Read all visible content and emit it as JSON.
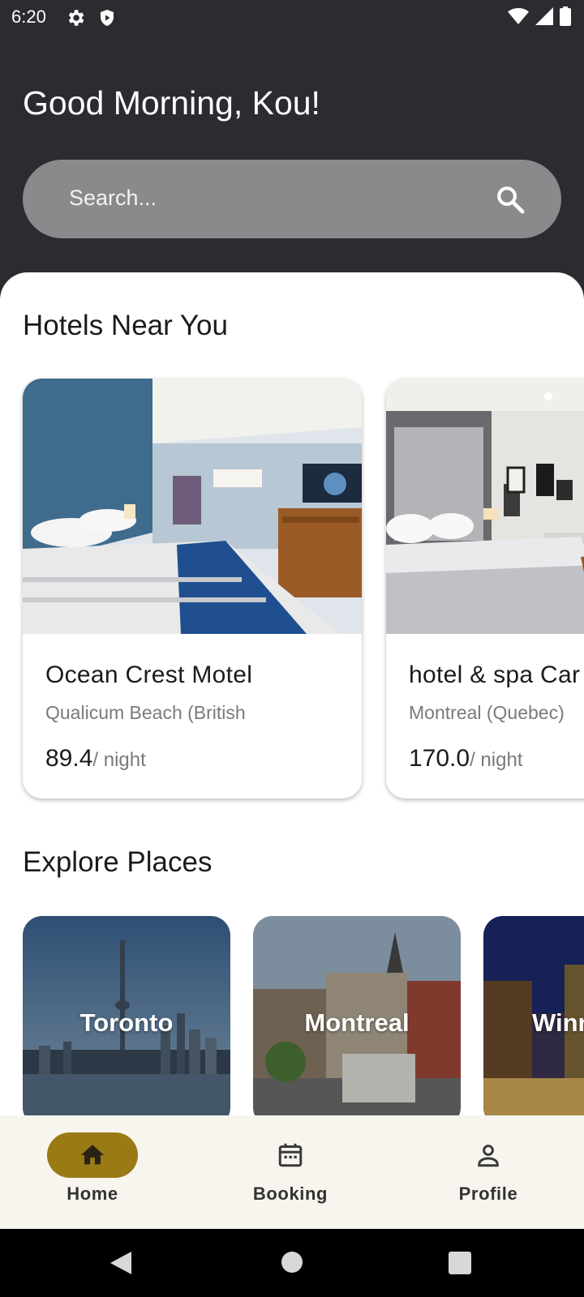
{
  "status_bar": {
    "time": "6:20",
    "left_icons": [
      "gear-icon",
      "shield-icon"
    ],
    "right_icons": [
      "wifi-icon",
      "signal-icon",
      "battery-icon"
    ]
  },
  "header": {
    "greeting": "Good Morning, Kou!",
    "search": {
      "placeholder": "Search...",
      "icon": "search-icon"
    }
  },
  "hotels_section": {
    "title": "Hotels Near You",
    "hotels": [
      {
        "name": "Ocean Crest Motel",
        "location": "Qualicum Beach (British",
        "price": "89.4",
        "unit": "/ night"
      },
      {
        "name": "hotel & spa Car",
        "location": "Montreal (Quebec)",
        "price": "170.0",
        "unit": "/ night"
      }
    ]
  },
  "places_section": {
    "title": "Explore Places",
    "places": [
      {
        "name": "Toronto"
      },
      {
        "name": "Montreal"
      },
      {
        "name": "Winn"
      }
    ]
  },
  "bottom_nav": {
    "items": [
      {
        "label": "Home",
        "icon": "home-icon",
        "active": true
      },
      {
        "label": "Booking",
        "icon": "calendar-icon",
        "active": false
      },
      {
        "label": "Profile",
        "icon": "person-icon",
        "active": false
      }
    ]
  },
  "system_nav": {
    "buttons": [
      "back-icon",
      "home-circle-icon",
      "recents-icon"
    ]
  },
  "colors": {
    "header_bg": "#2b2b30",
    "search_bg": "#8a8a8d",
    "accent": "#9a7a14",
    "nav_bg": "#f7f5ee"
  }
}
